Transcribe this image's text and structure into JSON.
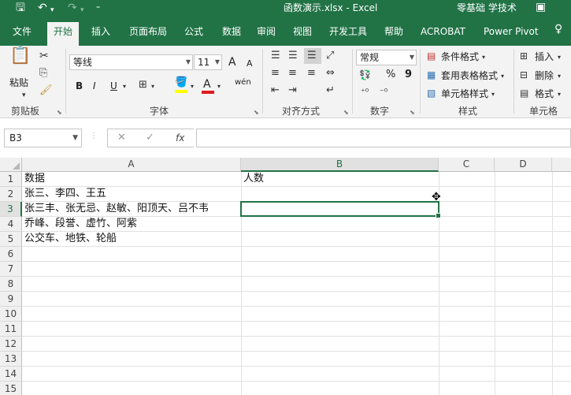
{
  "titlebar": {
    "title": "函数演示.xlsx  -  Excel",
    "user": "零基础 学技术",
    "save_icon": "save-icon",
    "undo_icon": "undo-icon",
    "redo_icon": "redo-icon"
  },
  "tabs": [
    "文件",
    "开始",
    "插入",
    "页面布局",
    "公式",
    "数据",
    "审阅",
    "视图",
    "开发工具",
    "帮助",
    "ACROBAT",
    "Power Pivot"
  ],
  "ribbon": {
    "clipboard": {
      "label": "剪贴板",
      "paste": "粘贴"
    },
    "font": {
      "label": "字体",
      "name": "等线",
      "size": "11",
      "grow": "A",
      "shrink": "A",
      "bold": "B",
      "italic": "I",
      "underline": "U",
      "wen": "wén",
      "font_color": "A"
    },
    "alignment": {
      "label": "对齐方式"
    },
    "number": {
      "label": "数字",
      "format": "常规",
      "percent": "%",
      "comma": "9"
    },
    "styles": {
      "label": "样式",
      "conditional": "条件格式",
      "table": "套用表格格式",
      "cell_styles": "单元格样式"
    },
    "cells": {
      "label": "单元格",
      "insert": "插入",
      "delete": "删除",
      "format": "格式"
    }
  },
  "formula_bar": {
    "name_box": "B3",
    "fx": "fx",
    "value": ""
  },
  "grid": {
    "columns": [
      "A",
      "B",
      "C",
      "D"
    ],
    "rows": [
      "1",
      "2",
      "3",
      "4",
      "5",
      "6",
      "7",
      "8",
      "9",
      "10",
      "11",
      "12",
      "13",
      "14",
      "15"
    ],
    "cells": {
      "A1": "数据",
      "B1": "人数",
      "A2": "张三、李四、王五",
      "A3": "张三丰、张无忌、赵敏、阳顶天、吕不韦",
      "A4": "乔峰、段誉、虚竹、阿紫",
      "A5": "公交车、地铁、轮船"
    },
    "selected_cell": "B3"
  }
}
